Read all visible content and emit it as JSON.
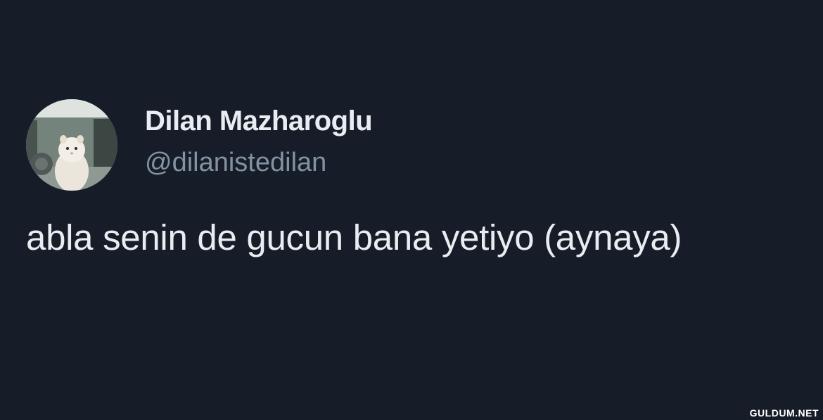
{
  "tweet": {
    "author": {
      "display_name": "Dilan Mazharoglu",
      "handle": "@dilanistedilan",
      "avatar": "avatar-white-hamster-photo"
    },
    "text": "abla senin de gucun bana yetiyo (aynaya)"
  },
  "watermark": {
    "text": "GULDUM.NET"
  },
  "colors": {
    "background": "#161d28",
    "primary_text": "#e9edf1",
    "secondary_text": "#8391a2"
  }
}
